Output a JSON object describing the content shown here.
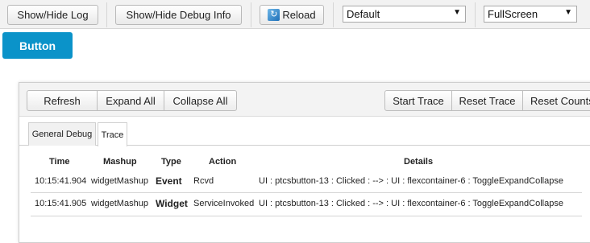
{
  "toolbar": {
    "show_hide_log": "Show/Hide Log",
    "show_hide_debug": "Show/Hide Debug Info",
    "reload": "Reload",
    "theme_select": "Default",
    "mode_select": "FullScreen"
  },
  "widget_button": {
    "label": "Button",
    "color": "#0b93c9"
  },
  "debug_panel": {
    "buttons": {
      "refresh": "Refresh",
      "expand_all": "Expand All",
      "collapse_all": "Collapse All",
      "start_trace": "Start Trace",
      "reset_trace": "Reset Trace",
      "reset_counts": "Reset Counts"
    },
    "tabs": [
      {
        "label": "General Debug",
        "active": false
      },
      {
        "label": "Trace",
        "active": true
      }
    ],
    "table": {
      "headers": [
        "Time",
        "Mashup",
        "Type",
        "Action",
        "Details"
      ],
      "rows": [
        {
          "time": "10:15:41.904",
          "mashup": "widgetMashup",
          "type": "Event",
          "action": "Rcvd",
          "details": "UI : ptcsbutton-13 : Clicked : --> : UI : flexcontainer-6 : ToggleExpandCollapse"
        },
        {
          "time": "10:15:41.905",
          "mashup": "widgetMashup",
          "type": "Widget",
          "action": "ServiceInvoked",
          "details": "UI : ptcsbutton-13 : Clicked : --> : UI : flexcontainer-6 : ToggleExpandCollapse"
        }
      ]
    }
  }
}
